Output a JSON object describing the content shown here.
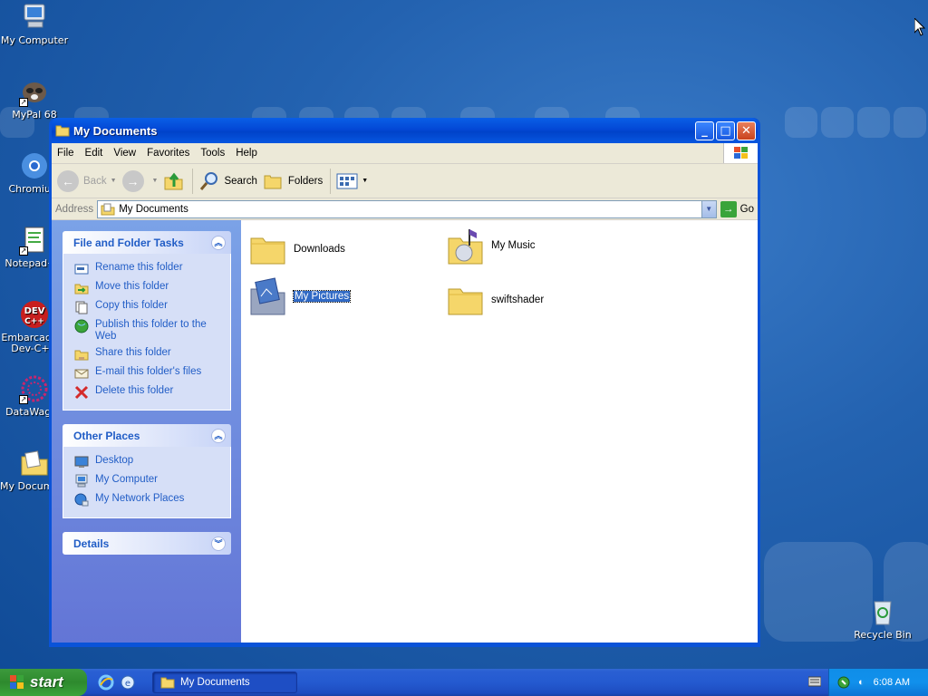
{
  "desktop": {
    "icons": [
      {
        "label": "My Computer"
      },
      {
        "label": "MyPal 68"
      },
      {
        "label": "Chromium"
      },
      {
        "label": "Notepad++"
      },
      {
        "label": "Embarcadero Dev-C++"
      },
      {
        "label": "DataWagon"
      },
      {
        "label": "My Documents"
      },
      {
        "label": "Recycle Bin"
      }
    ]
  },
  "window": {
    "title": "My Documents",
    "menu": [
      "File",
      "Edit",
      "View",
      "Favorites",
      "Tools",
      "Help"
    ],
    "toolbar": {
      "back": "Back",
      "search": "Search",
      "folders": "Folders"
    },
    "address": {
      "label": "Address",
      "value": "My Documents",
      "go": "Go"
    },
    "panels": {
      "file_tasks": {
        "title": "File and Folder Tasks",
        "items": [
          "Rename this folder",
          "Move this folder",
          "Copy this folder",
          "Publish this folder to the Web",
          "Share this folder",
          "E-mail this folder's files",
          "Delete this folder"
        ]
      },
      "other_places": {
        "title": "Other Places",
        "items": [
          "Desktop",
          "My Computer",
          "My Network Places"
        ]
      },
      "details": {
        "title": "Details"
      }
    },
    "files": [
      {
        "name": "Downloads",
        "icon": "folder-icon"
      },
      {
        "name": "My Music",
        "icon": "music-folder-icon"
      },
      {
        "name": "My Pictures",
        "icon": "pictures-folder-icon",
        "selected": true
      },
      {
        "name": "swiftshader",
        "icon": "folder-icon"
      }
    ]
  },
  "taskbar": {
    "start": "start",
    "task_button": "My Documents",
    "clock": "6:08 AM"
  }
}
